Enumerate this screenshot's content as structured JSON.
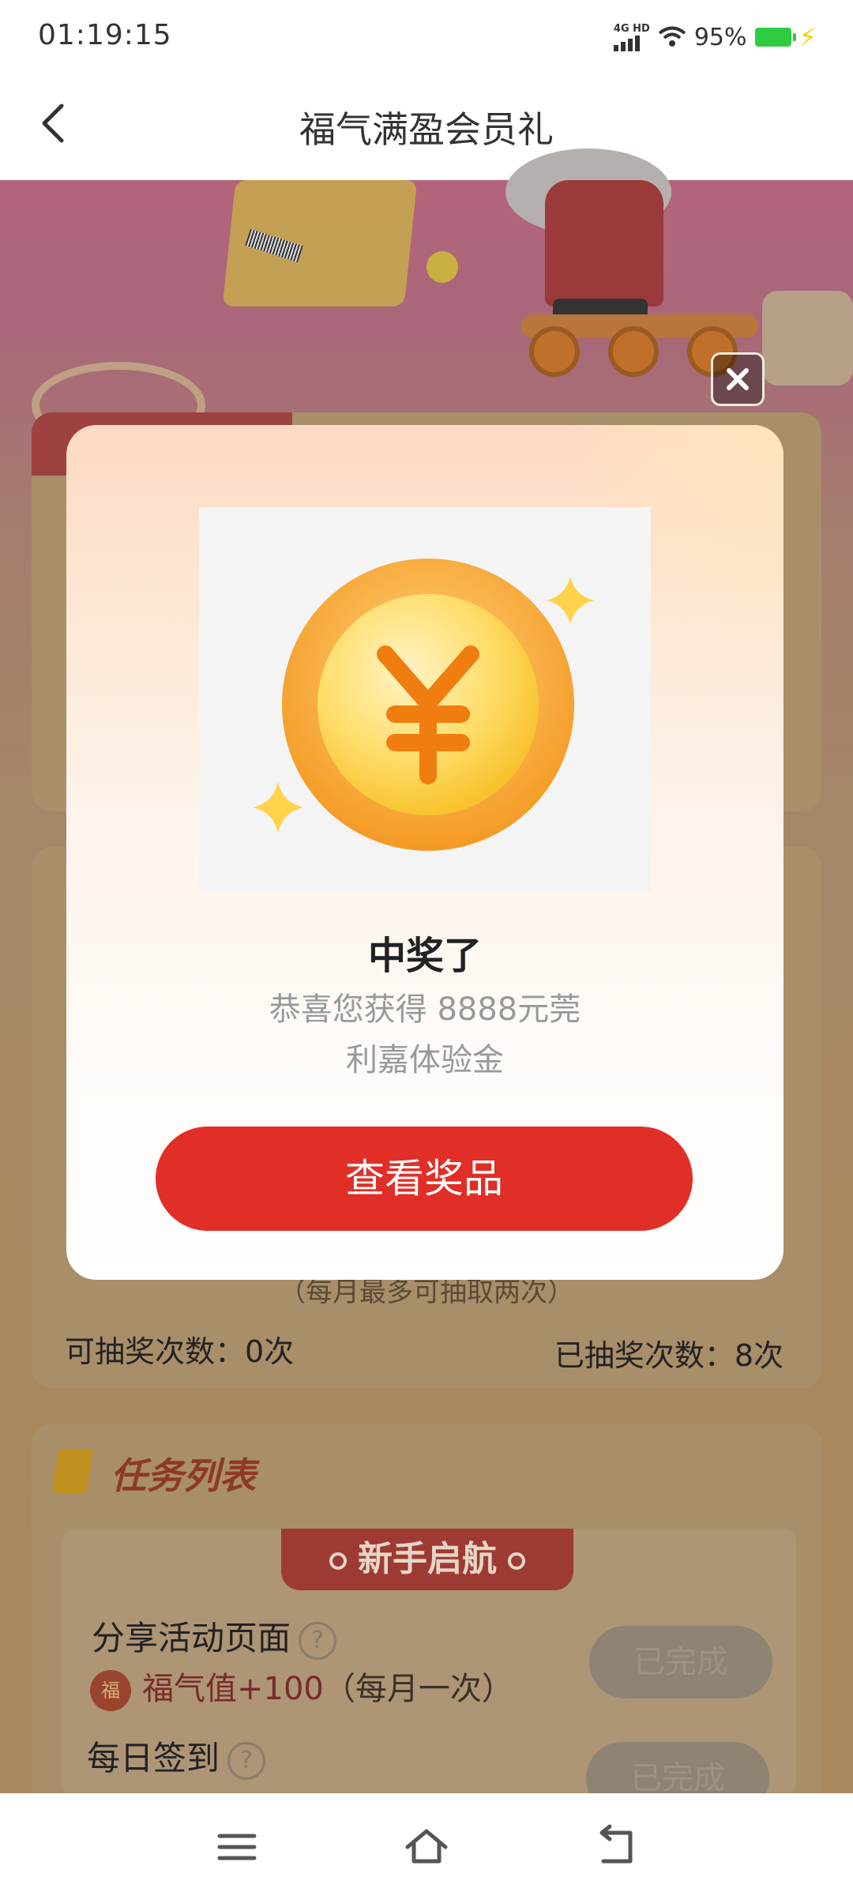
{
  "status_bar": {
    "time": "01:19:15",
    "network": "4G HD",
    "battery": "95%"
  },
  "header": {
    "title": "福气满盈会员礼",
    "back_icon": "chevron-left-icon"
  },
  "lottery": {
    "note": "（每月最多可抽取两次）",
    "remaining_label": "可抽奖次数：0次",
    "used_label": "已抽奖次数：8次"
  },
  "tasks": {
    "title": "任务列表",
    "section": "新手启航",
    "items": [
      {
        "name": "分享活动页面",
        "reward": "福气值+100",
        "frequency": "（每月一次）",
        "button": "已完成"
      },
      {
        "name": "每日签到",
        "button": "已完成"
      }
    ],
    "bag_icon_text": "福"
  },
  "modal": {
    "heading": "中奖了",
    "message": "恭喜您获得  8888元莞利嘉体验金",
    "button": "查看奖品",
    "close_icon": "close-icon",
    "prize_icon": "yuan-coin-icon"
  },
  "colors": {
    "accent_red": "#e12e26",
    "coin_gold": "#f7a42a",
    "battery_green": "#2ecc40"
  },
  "system_nav": {
    "menu_icon": "menu-icon",
    "home_icon": "home-icon",
    "back_icon": "back-icon"
  }
}
